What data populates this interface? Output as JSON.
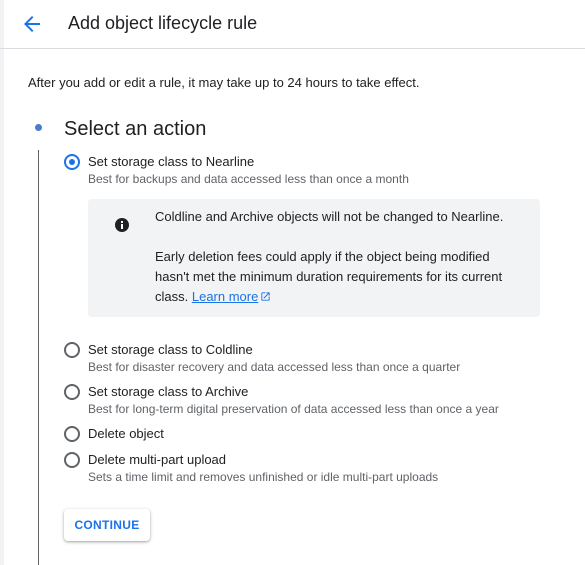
{
  "header": {
    "title": "Add object lifecycle rule"
  },
  "intro_text": "After you add or edit a rule, it may take up to 24 hours to take effect.",
  "step": {
    "title": "Select an action"
  },
  "options": [
    {
      "label": "Set storage class to Nearline",
      "description": "Best for backups and data accessed less than once a month",
      "selected": true
    },
    {
      "label": "Set storage class to Coldline",
      "description": "Best for disaster recovery and data accessed less than once a quarter",
      "selected": false
    },
    {
      "label": "Set storage class to Archive",
      "description": "Best for long-term digital preservation of data accessed less than once a year",
      "selected": false
    },
    {
      "label": "Delete object",
      "description": "",
      "selected": false
    },
    {
      "label": "Delete multi-part upload",
      "description": "Sets a time limit and removes unfinished or idle multi-part uploads",
      "selected": false
    }
  ],
  "info": {
    "icon": "info-icon",
    "line1": "Coldline and Archive objects will not be changed to Nearline.",
    "line2": "Early deletion fees could apply if the object being modified hasn't met the minimum duration requirements for its current class.",
    "link_label": "Learn more",
    "link_icon": "external-link-icon"
  },
  "continue_label": "CONTINUE",
  "colors": {
    "accent": "#1a73e8",
    "step_dot": "#4a7bd0",
    "info_bg": "#f1f3f4",
    "text": "#202124",
    "secondary_text": "#5f6368"
  }
}
